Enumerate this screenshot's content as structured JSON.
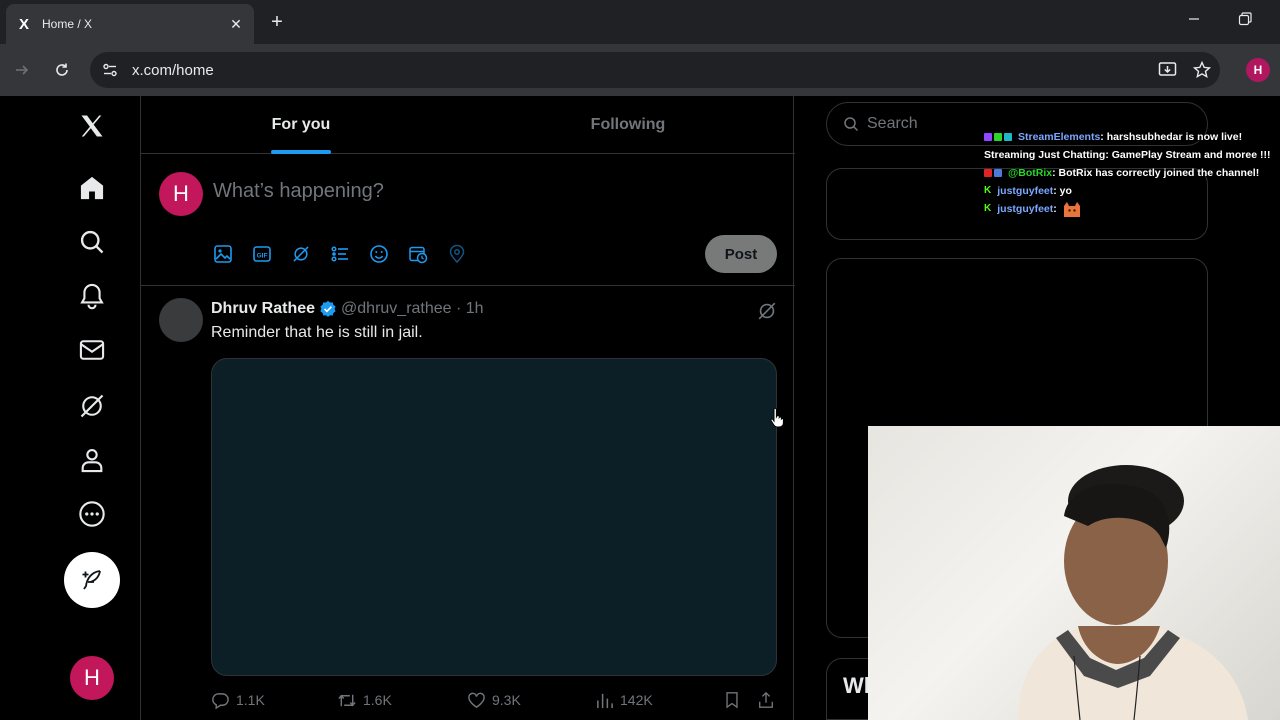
{
  "browser": {
    "tab_title": "Home / X",
    "tab_favicon": "X",
    "url": "x.com/home",
    "profile_initial": "H"
  },
  "nav": {
    "items": [
      "home-icon",
      "search-icon",
      "bell-icon",
      "mail-icon",
      "grok-icon",
      "profile-icon",
      "more-icon"
    ],
    "avatar_initial": "H"
  },
  "tabs": {
    "for_you": "For you",
    "following": "Following"
  },
  "composer": {
    "avatar_initial": "H",
    "placeholder": "What’s happening?",
    "post_label": "Post",
    "tools": [
      "image-icon",
      "gif-icon",
      "grok-icon",
      "poll-icon",
      "emoji-icon",
      "schedule-icon",
      "location-icon"
    ]
  },
  "tweet": {
    "name": "Dhruv Rathee",
    "handle": "@dhruv_rathee · 1h",
    "text": "Reminder that he is still in jail.",
    "replies": "1.1K",
    "reposts": "1.6K",
    "likes": "9.3K",
    "views": "142K"
  },
  "search": {
    "placeholder": "Search"
  },
  "trending_partial": "Wl",
  "chat": {
    "line1_user": "StreamElements",
    "line1_text": ": harshsubhedar is now live!",
    "line1_cont": "Streaming Just Chatting: GamePlay Stream and moree !!!",
    "line2_user": "@BotRix",
    "line2_text": ": BotRix has correctly joined the channel!",
    "line3_user": "justguyfeet",
    "line3_text": ": yo",
    "line4_user": "justguyfeet",
    "line4_text": ":",
    "kick_badge": "K"
  },
  "colors": {
    "accent": "#1d9bf0",
    "avatar": "#c2185b",
    "border": "#2f3336",
    "muted": "#71767b"
  }
}
